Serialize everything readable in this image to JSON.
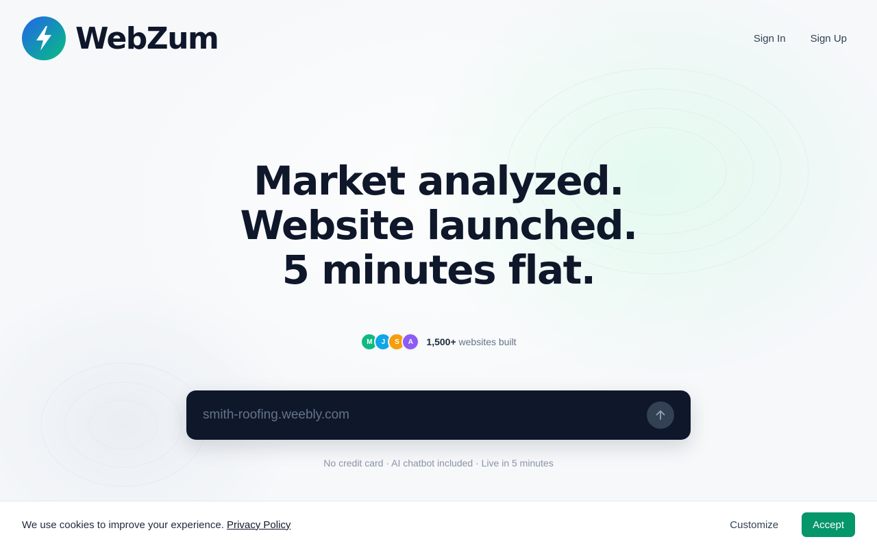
{
  "brand": {
    "name": "WebZum",
    "logo_icon": "lightning-bolt-icon"
  },
  "nav": {
    "sign_in": "Sign In",
    "sign_up": "Sign Up"
  },
  "hero": {
    "line1": "Market analyzed.",
    "line2": "Website launched.",
    "line3": "5 minutes flat."
  },
  "social_proof": {
    "avatars": [
      {
        "initial": "M",
        "color": "#10b981"
      },
      {
        "initial": "J",
        "color": "#0ea5e9"
      },
      {
        "initial": "S",
        "color": "#f59e0b"
      },
      {
        "initial": "A",
        "color": "#8b5cf6"
      }
    ],
    "count": "1,500+",
    "label": "websites built"
  },
  "search": {
    "placeholder": "smith-roofing.weebly.com",
    "value": "",
    "submit_icon": "arrow-up-icon"
  },
  "features_line": "No credit card · AI chatbot included · Live in 5 minutes",
  "cookie_banner": {
    "text": "We use cookies to improve your experience.",
    "policy_link": "Privacy Policy",
    "customize_label": "Customize",
    "accept_label": "Accept"
  },
  "colors": {
    "accent": "#059669",
    "dark": "#0f172a",
    "logo_gradient_start": "#2563eb",
    "logo_gradient_end": "#10b981"
  }
}
